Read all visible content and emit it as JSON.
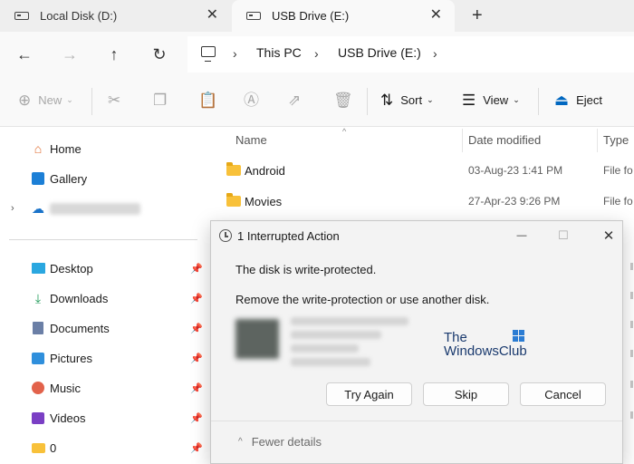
{
  "tabs": [
    {
      "label": "Local Disk (D:)",
      "icon": "drive-icon",
      "close": "✕"
    },
    {
      "label": "USB Drive (E:)",
      "icon": "usb-drive-icon",
      "close": "✕"
    }
  ],
  "new_tab": "+",
  "breadcrumb": {
    "items": [
      "This PC",
      "USB Drive (E:)"
    ],
    "separator": "›"
  },
  "nav": {
    "back": "←",
    "forward": "→",
    "up": "↑",
    "refresh": "↻"
  },
  "toolbar": {
    "new": "New",
    "sort": "Sort",
    "view": "View",
    "eject": "Eject"
  },
  "sidebar": {
    "top": [
      {
        "label": "Home",
        "icon": "home-icon"
      },
      {
        "label": "Gallery",
        "icon": "gallery-icon"
      }
    ],
    "pinned": [
      {
        "label": "Desktop",
        "icon": "desktop-icon"
      },
      {
        "label": "Downloads",
        "icon": "downloads-icon"
      },
      {
        "label": "Documents",
        "icon": "documents-icon"
      },
      {
        "label": "Pictures",
        "icon": "pictures-icon"
      },
      {
        "label": "Music",
        "icon": "music-icon"
      },
      {
        "label": "Videos",
        "icon": "videos-icon"
      },
      {
        "label": "0",
        "icon": "folder-icon"
      }
    ]
  },
  "filelist": {
    "columns": [
      "Name",
      "Date modified",
      "Type"
    ],
    "rows": [
      {
        "name": "Android",
        "date": "03-Aug-23 1:41 PM",
        "type": "File fo"
      },
      {
        "name": "Movies",
        "date": "27-Apr-23 9:26 PM",
        "type": "File fo"
      }
    ]
  },
  "dialog": {
    "title": "1 Interrupted Action",
    "message1": "The disk is write-protected.",
    "message2": "Remove the write-protection or use another disk.",
    "watermark_line1": "The",
    "watermark_line2": "WindowsClub",
    "buttons": {
      "try_again": "Try Again",
      "skip": "Skip",
      "cancel": "Cancel"
    },
    "fewer_details": "Fewer details",
    "minimize": "—",
    "maximize": "☐",
    "close": "✕"
  },
  "colors": {
    "accent": "#0067c0",
    "folder": "#f8c13a",
    "tab_bar": "#eeeeee",
    "dialog_bg": "#f3f3f3"
  }
}
